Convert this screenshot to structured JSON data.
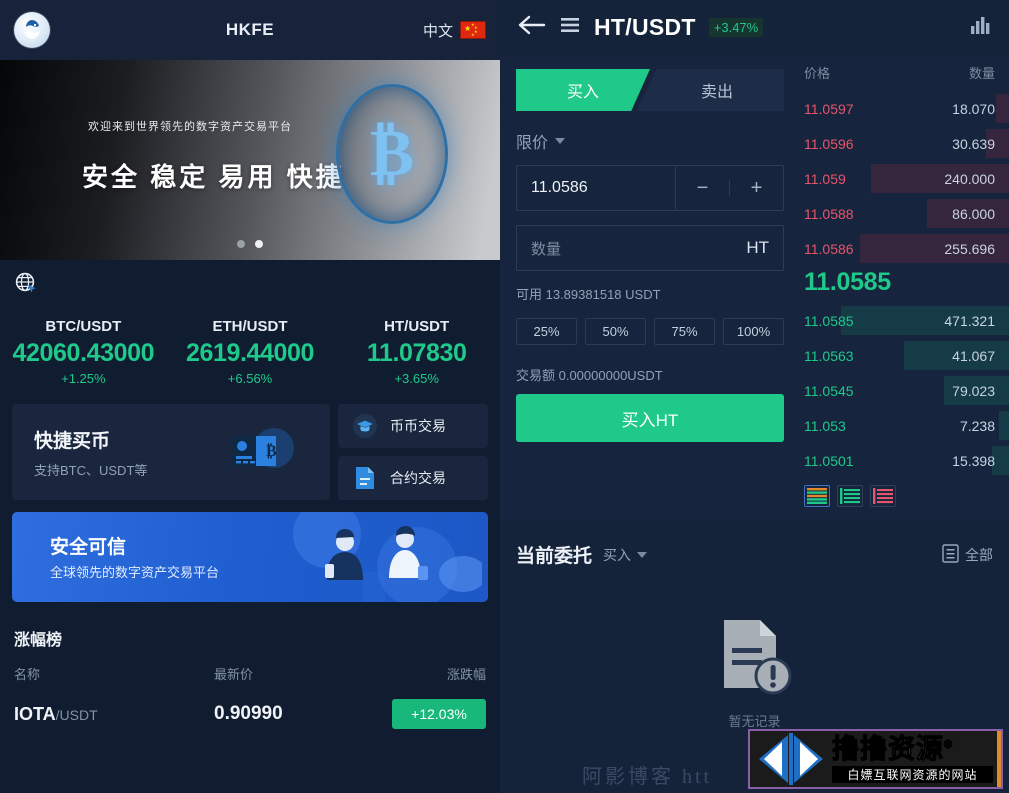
{
  "left": {
    "header": {
      "logo_icon": "whale-logo-icon",
      "title": "HKFE",
      "lang_label": "中文",
      "flag_icon": "china-flag-icon"
    },
    "banner": {
      "subtitle": "欢迎来到世界领先的数字资产交易平台",
      "title": "安全 稳定 易用 快捷",
      "coin_icon": "bitcoin-coin-icon",
      "dots": 2,
      "active_dot": 2
    },
    "notice": {
      "icon": "announcement-globe-icon"
    },
    "tickers": [
      {
        "pair": "BTC/USDT",
        "price": "42060.43000",
        "change": "+1.25%"
      },
      {
        "pair": "ETH/USDT",
        "price": "2619.44000",
        "change": "+6.56%"
      },
      {
        "pair": "HT/USDT",
        "price": "11.07830",
        "change": "+3.65%"
      }
    ],
    "quick_card": {
      "title": "快捷买币",
      "subtitle": "支持BTC、USDT等",
      "art_icon": "credit-card-bitcoin-icon"
    },
    "quick_links": [
      {
        "label": "币币交易",
        "icon": "graduation-cap-icon"
      },
      {
        "label": "合约交易",
        "icon": "contract-document-icon"
      }
    ],
    "promo": {
      "title": "安全可信",
      "subtitle": "全球领先的数字资产交易平台",
      "art_icon": "people-illustration-icon"
    },
    "rank": {
      "title": "涨幅榜",
      "columns": [
        "名称",
        "最新价",
        "涨跌幅"
      ],
      "rows": [
        {
          "base": "IOTA",
          "quote": "/USDT",
          "price": "0.90990",
          "change": "+12.03%"
        }
      ]
    }
  },
  "right": {
    "header": {
      "back_icon": "back-arrow-icon",
      "menu_icon": "hamburger-menu-icon",
      "title": "HT/USDT",
      "change_badge": "+3.47%",
      "chart_icon": "bar-chart-icon"
    },
    "trade": {
      "tabs": [
        {
          "label": "买入",
          "active": true
        },
        {
          "label": "卖出",
          "active": false
        }
      ],
      "order_type": "限价",
      "price_value": "11.0586",
      "minus_label": "−",
      "plus_label": "+",
      "qty_placeholder": "数量",
      "qty_unit": "HT",
      "available": "可用 13.89381518 USDT",
      "percents": [
        "25%",
        "50%",
        "75%",
        "100%"
      ],
      "total": "交易额 0.00000000USDT",
      "submit_label": "买入HT"
    },
    "book": {
      "col_price": "价格",
      "col_amount": "数量",
      "asks": [
        {
          "price": "11.0597",
          "amount": "18.070",
          "depth": 7
        },
        {
          "price": "11.0596",
          "amount": "30.639",
          "depth": 12
        },
        {
          "price": "11.059",
          "amount": "240.000",
          "depth": 72
        },
        {
          "price": "11.0588",
          "amount": "86.000",
          "depth": 43
        },
        {
          "price": "11.0586",
          "amount": "255.696",
          "depth": 78
        }
      ],
      "last_price": "11.0585",
      "bids": [
        {
          "price": "11.0585",
          "amount": "471.321",
          "depth": 88
        },
        {
          "price": "11.0563",
          "amount": "41.067",
          "depth": 55
        },
        {
          "price": "11.0545",
          "amount": "79.023",
          "depth": 34
        },
        {
          "price": "11.053",
          "amount": "7.238",
          "depth": 5
        },
        {
          "price": "11.0501",
          "amount": "15.398",
          "depth": 9
        }
      ],
      "depth_toggles": [
        {
          "icon": "depth-both-icon",
          "active": true
        },
        {
          "icon": "depth-bids-icon",
          "active": false
        },
        {
          "icon": "depth-asks-icon",
          "active": false
        }
      ]
    },
    "orders": {
      "title": "当前委托",
      "filter": "买入",
      "all_label": "全部",
      "all_icon": "list-document-icon",
      "empty_icon": "no-record-document-icon",
      "empty_label": "暂无记录"
    }
  },
  "watermark": {
    "faint_text": "阿影博客 htt",
    "logo_main": "撸撸资源",
    "logo_reg": "®",
    "logo_sub": "白嫖互联网资源的网站",
    "logo_icon": "double-arrow-logo-icon"
  },
  "colors": {
    "up": "#1ec98a",
    "down": "#e6556b",
    "brand_blue": "#2f6ede",
    "bg": "#101d30"
  }
}
